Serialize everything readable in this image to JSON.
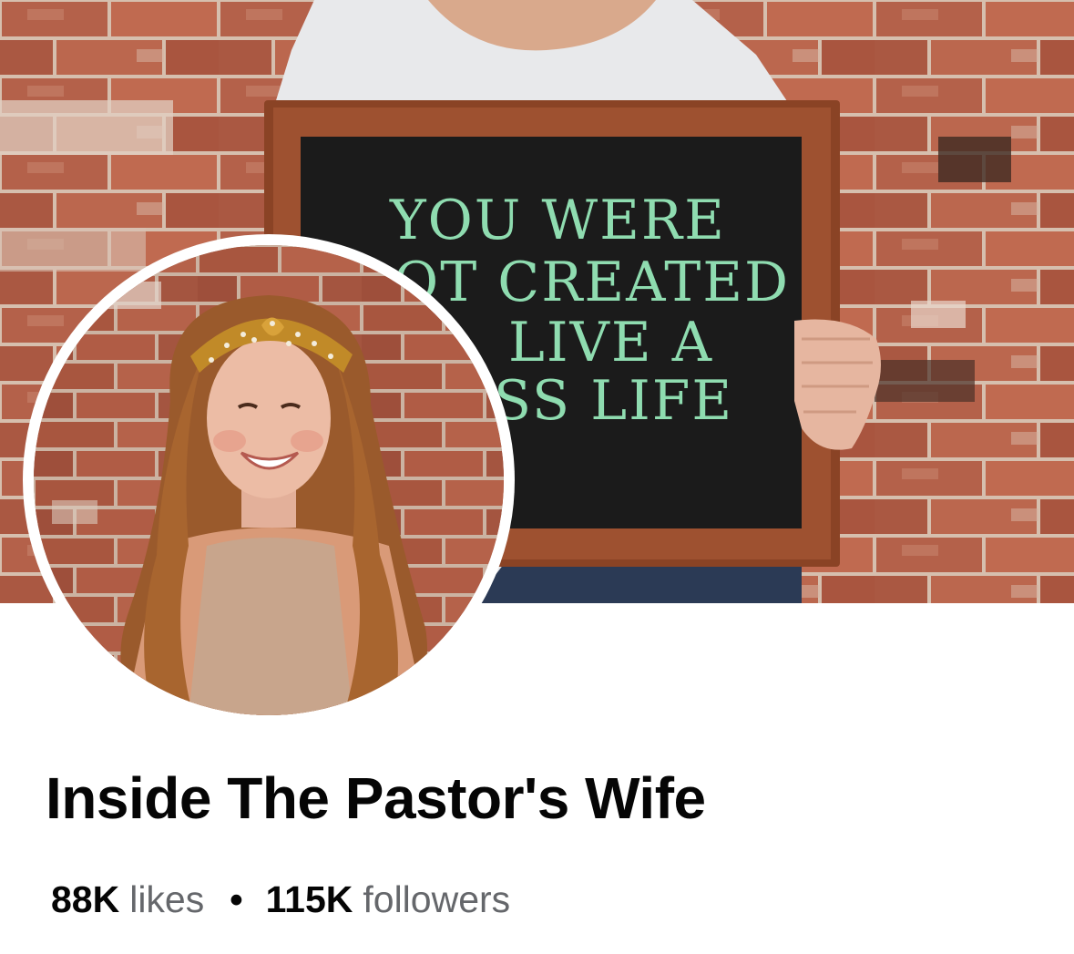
{
  "cover": {
    "sign_lines": [
      "YOU WERE",
      "OT CREATED",
      "LIVE A",
      "SS LIFE"
    ],
    "sign_text_color": "#8fdcb0",
    "sign_board_color": "#1b1b1b",
    "frame_color": "#8a4325",
    "brick_color": "#b4614a",
    "mortar_color": "#d9c4b4"
  },
  "profile": {
    "headband_color": "#c18a28",
    "hair_color": "#9a5a2c"
  },
  "page": {
    "name": "Inside The Pastor's Wife",
    "likes_count": "88K",
    "likes_label": "likes",
    "separator": "•",
    "followers_count": "115K",
    "followers_label": "followers"
  }
}
